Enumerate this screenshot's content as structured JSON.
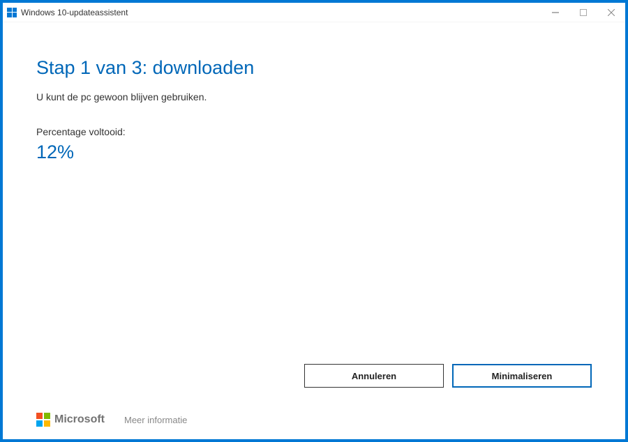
{
  "window": {
    "title": "Windows 10-updateassistent"
  },
  "content": {
    "heading": "Stap 1 van 3: downloaden",
    "subtext": "U kunt de pc gewoon blijven gebruiken.",
    "progress_label": "Percentage voltooid:",
    "progress_value": "12%"
  },
  "buttons": {
    "cancel": "Annuleren",
    "minimize": "Minimaliseren"
  },
  "footer": {
    "brand": "Microsoft",
    "more_info": "Meer informatie"
  }
}
